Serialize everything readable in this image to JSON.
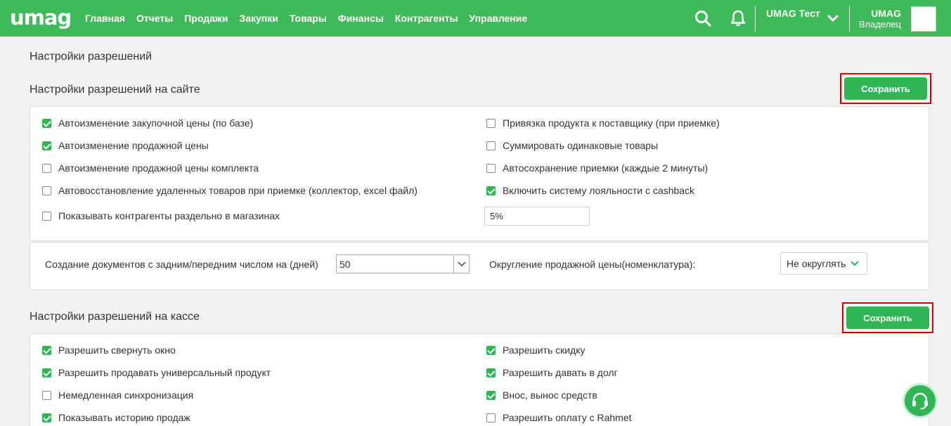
{
  "header": {
    "logo": "umag",
    "nav": [
      "Главная",
      "Отчеты",
      "Продажи",
      "Закупки",
      "Товары",
      "Финансы",
      "Контрагенты",
      "Управление"
    ],
    "company": "UMAG Тест",
    "user_name": "UMAG",
    "user_role": "Владелец"
  },
  "page": {
    "title": "Настройки разрешений",
    "site_section_title": "Настройки разрешений на сайте",
    "pos_section_title": "Настройки разрешений на кассе",
    "save_label": "Сохранить"
  },
  "site": {
    "left": [
      {
        "label": "Автоизменение закупочной цены (по базе)",
        "checked": true
      },
      {
        "label": "Автоизменение продажной цены",
        "checked": true
      },
      {
        "label": "Автоизменение продажной цены комплекта",
        "checked": false
      },
      {
        "label": "Автовосстановление удаленных товаров при приемке (коллектор, excel файл)",
        "checked": false
      },
      {
        "label": "Показывать контрагенты раздельно в магазинах",
        "checked": false
      }
    ],
    "right": [
      {
        "label": "Привязка продукта к поставщику (при приемке)",
        "checked": false
      },
      {
        "label": "Суммировать одинаковые товары",
        "checked": false
      },
      {
        "label": "Автосохранение приемки (каждые 2 минуты)",
        "checked": false
      },
      {
        "label": "Включить систему лояльности с cashback",
        "checked": true
      }
    ],
    "cashback_value": "5%"
  },
  "docs": {
    "days_label": "Создание документов с задним/передним числом на (дней)",
    "days_value": "50",
    "rounding_label": "Округление продажной цены(номенклатура):",
    "rounding_value": "Не округлять"
  },
  "pos": {
    "left": [
      {
        "label": "Разрешить свернуть окно",
        "checked": true
      },
      {
        "label": "Разрешить продавать универсальный продукт",
        "checked": true
      },
      {
        "label": "Немедленная синхронизация",
        "checked": false
      },
      {
        "label": "Показывать историю продаж",
        "checked": true
      }
    ],
    "right": [
      {
        "label": "Разрешить скидку",
        "checked": true
      },
      {
        "label": "Разрешить давать в долг",
        "checked": true
      },
      {
        "label": "Внос, вынос средств",
        "checked": true
      },
      {
        "label": "Разрешить оплату с Rahmet",
        "checked": false
      }
    ]
  },
  "colors": {
    "brand": "#3fba5a",
    "button": "#30b655",
    "highlight": "#e00000"
  }
}
